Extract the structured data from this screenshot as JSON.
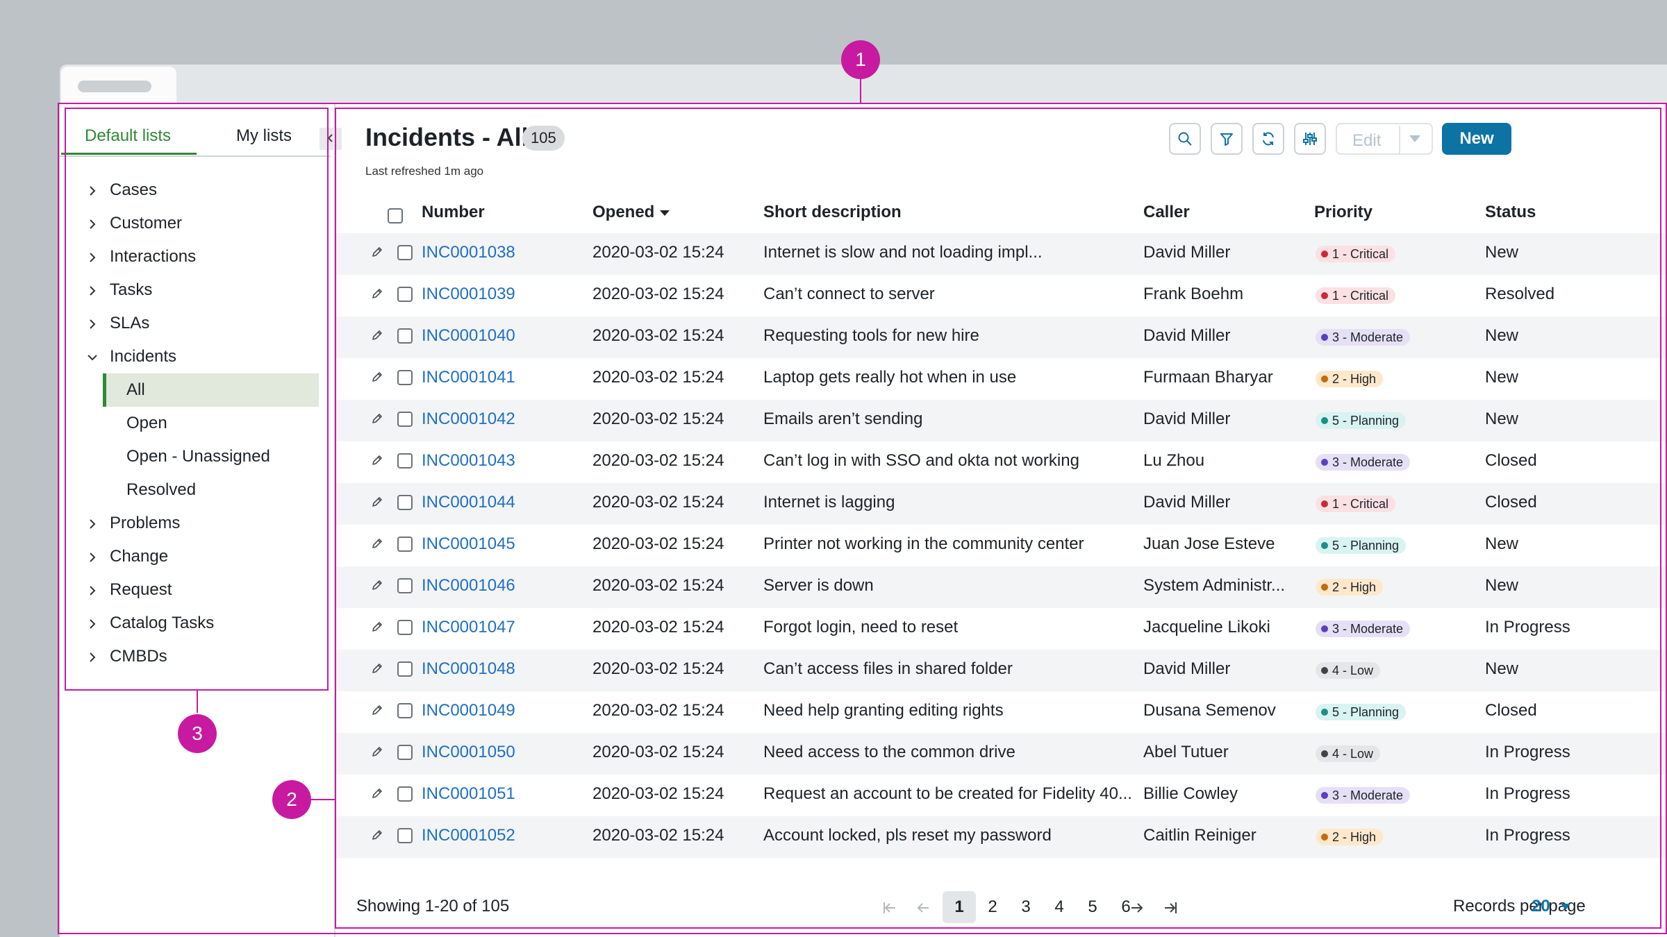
{
  "sidebar": {
    "tabs": [
      "Default lists",
      "My lists"
    ],
    "items": [
      {
        "label": "Cases",
        "expanded": false
      },
      {
        "label": "Customer",
        "expanded": false
      },
      {
        "label": "Interactions",
        "expanded": false
      },
      {
        "label": "Tasks",
        "expanded": false
      },
      {
        "label": "SLAs",
        "expanded": false
      },
      {
        "label": "Incidents",
        "expanded": true
      }
    ],
    "incident_subitems": [
      "All",
      "Open",
      "Open - Unassigned",
      "Resolved"
    ],
    "selected_subitem": "All",
    "items_after": [
      {
        "label": "Problems"
      },
      {
        "label": "Change"
      },
      {
        "label": "Request"
      },
      {
        "label": "Catalog Tasks"
      },
      {
        "label": "CMBDs"
      }
    ]
  },
  "header": {
    "title": "Incidents - All",
    "count": "105",
    "refreshed": "Last refreshed 1m ago",
    "tools": [
      "search-icon",
      "filter-icon",
      "refresh-icon",
      "settings-sliders-icon"
    ],
    "edit_label": "Edit",
    "new_label": "New"
  },
  "table": {
    "columns": [
      "Number",
      "Opened",
      "Short description",
      "Caller",
      "Priority",
      "Status"
    ],
    "sorted_column": "Opened",
    "rows": [
      {
        "number": "INC0001038",
        "opened": "2020-03-02 15:24",
        "desc": "Internet is slow and not loading impl...",
        "caller": "David Miller",
        "priority": "1 - Critical",
        "status": "New"
      },
      {
        "number": "INC0001039",
        "opened": "2020-03-02 15:24",
        "desc": "Can’t connect to server",
        "caller": "Frank Boehm",
        "priority": "1 - Critical",
        "status": "Resolved"
      },
      {
        "number": "INC0001040",
        "opened": "2020-03-02 15:24",
        "desc": "Requesting tools for new hire",
        "caller": "David Miller",
        "priority": "3 - Moderate",
        "status": "New"
      },
      {
        "number": "INC0001041",
        "opened": "2020-03-02 15:24",
        "desc": "Laptop gets really hot when in use",
        "caller": "Furmaan Bharyar",
        "priority": "2 - High",
        "status": "New"
      },
      {
        "number": "INC0001042",
        "opened": "2020-03-02 15:24",
        "desc": "Emails aren’t sending",
        "caller": "David Miller",
        "priority": "5 - Planning",
        "status": "New"
      },
      {
        "number": "INC0001043",
        "opened": "2020-03-02 15:24",
        "desc": "Can’t log in with SSO and okta not working",
        "caller": "Lu Zhou",
        "priority": "3 - Moderate",
        "status": "Closed"
      },
      {
        "number": "INC0001044",
        "opened": "2020-03-02 15:24",
        "desc": "Internet is lagging",
        "caller": "David Miller",
        "priority": "1 - Critical",
        "status": "Closed"
      },
      {
        "number": "INC0001045",
        "opened": "2020-03-02 15:24",
        "desc": "Printer not working in the community center",
        "caller": "Juan Jose Esteve",
        "priority": "5 - Planning",
        "status": "New"
      },
      {
        "number": "INC0001046",
        "opened": "2020-03-02 15:24",
        "desc": "Server is down",
        "caller": "System Administr...",
        "priority": "2 - High",
        "status": "New"
      },
      {
        "number": "INC0001047",
        "opened": "2020-03-02 15:24",
        "desc": "Forgot login, need to reset",
        "caller": "Jacqueline Likoki",
        "priority": "3 - Moderate",
        "status": "In Progress"
      },
      {
        "number": "INC0001048",
        "opened": "2020-03-02 15:24",
        "desc": "Can’t access files in shared folder",
        "caller": "David Miller",
        "priority": "4 - Low",
        "status": "New"
      },
      {
        "number": "INC0001049",
        "opened": "2020-03-02 15:24",
        "desc": "Need help granting editing rights",
        "caller": "Dusana Semenov",
        "priority": "5 - Planning",
        "status": "Closed"
      },
      {
        "number": "INC0001050",
        "opened": "2020-03-02 15:24",
        "desc": "Need access to the common drive",
        "caller": "Abel Tutuer",
        "priority": "4 - Low",
        "status": "In Progress"
      },
      {
        "number": "INC0001051",
        "opened": "2020-03-02 15:24",
        "desc": "Request an account to be created for Fidelity 40...",
        "caller": "Billie Cowley",
        "priority": "3 - Moderate",
        "status": "In Progress"
      },
      {
        "number": "INC0001052",
        "opened": "2020-03-02 15:24",
        "desc": "Account locked, pls reset my password",
        "caller": "Caitlin Reiniger",
        "priority": "2 - High",
        "status": "In Progress"
      }
    ]
  },
  "priority_colors": {
    "1 - Critical": {
      "bg": "#fbe1e3",
      "dot": "#c92a39"
    },
    "2 - High": {
      "bg": "#fde8cc",
      "dot": "#c46a0a"
    },
    "3 - Moderate": {
      "bg": "#e6e0f6",
      "dot": "#5b3fc4"
    },
    "4 - Low": {
      "bg": "#e4e6e8",
      "dot": "#3d4448"
    },
    "5 - Planning": {
      "bg": "#d8f3f1",
      "dot": "#1a8f86"
    }
  },
  "footer": {
    "showing": "Showing 1-20 of 105",
    "pages": [
      "1",
      "2",
      "3",
      "4",
      "5",
      "6"
    ],
    "current_page": "1",
    "records_label": "Records per page",
    "records_value": "20"
  },
  "annotations": [
    "1",
    "2",
    "3"
  ],
  "colors": {
    "accent_green": "#2e8a34",
    "primary_blue": "#0d73a4",
    "link_blue": "#1f6fc6",
    "annotation_magenta": "#c81aa0"
  }
}
